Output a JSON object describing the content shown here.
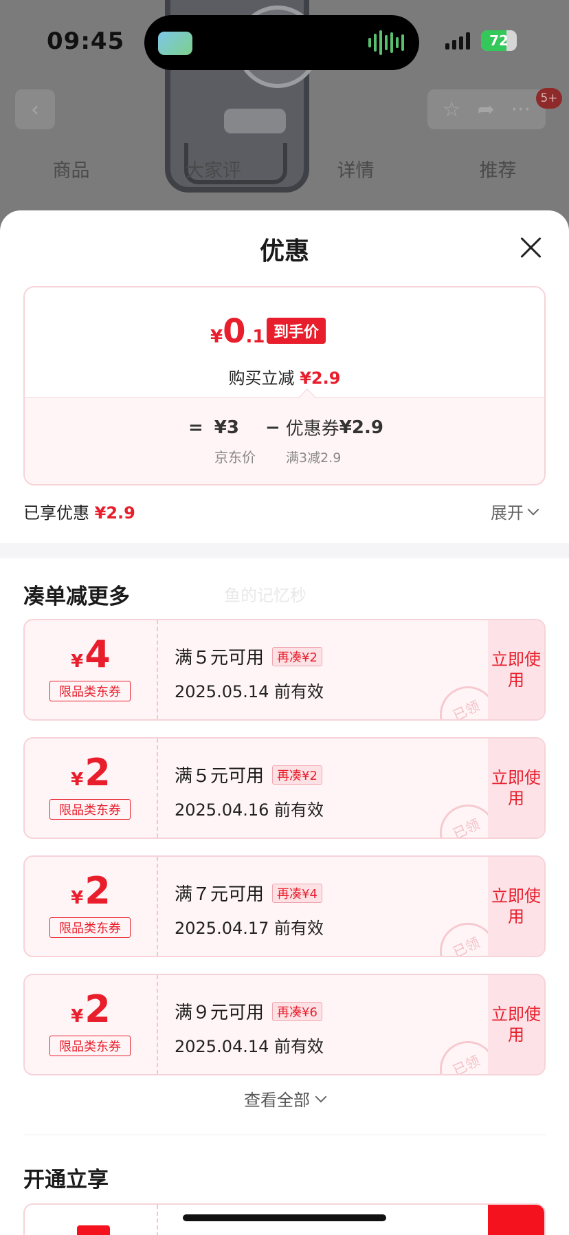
{
  "status_bar": {
    "time": "09:45",
    "battery": "72",
    "battery_level": 0.72
  },
  "background": {
    "badge": "5+",
    "tabs": [
      "商品",
      "大家评",
      "详情",
      "推荐"
    ]
  },
  "sheet": {
    "title": "优惠",
    "final_price": {
      "currency": "¥",
      "integer": "0",
      "decimal": ".1",
      "tag": "到手价"
    },
    "reduce": {
      "label": "购买立减",
      "amount": "¥2.9"
    },
    "calc": {
      "equals": "=",
      "base_price": "¥3",
      "minus": "−",
      "coupon_label": "优惠券",
      "coupon_amount": "¥2.9",
      "base_label": "京东价",
      "coupon_rule": "满3减2.9"
    },
    "enjoyed": {
      "label": "已享优惠",
      "amount": "¥2.9"
    },
    "expand_label": "展开",
    "section_more": "凑单减更多",
    "watermark": "鱼的记忆秒",
    "coupons": [
      {
        "currency": "¥",
        "amount": "4",
        "type": "限品类东券",
        "condition": "满５元可用",
        "more": "再凑¥2",
        "valid": "2025.05.14 前有效",
        "stamp": "已领",
        "use": "立即使用"
      },
      {
        "currency": "¥",
        "amount": "2",
        "type": "限品类东券",
        "condition": "满５元可用",
        "more": "再凑¥2",
        "valid": "2025.04.16 前有效",
        "stamp": "已领",
        "use": "立即使用"
      },
      {
        "currency": "¥",
        "amount": "2",
        "type": "限品类东券",
        "condition": "满７元可用",
        "more": "再凑¥4",
        "valid": "2025.04.17 前有效",
        "stamp": "已领",
        "use": "立即使用"
      },
      {
        "currency": "¥",
        "amount": "2",
        "type": "限品类东券",
        "condition": "满９元可用",
        "more": "再凑¥6",
        "valid": "2025.04.14 前有效",
        "stamp": "已领",
        "use": "立即使用"
      }
    ],
    "view_all": "查看全部",
    "section_open": "开通立享"
  }
}
